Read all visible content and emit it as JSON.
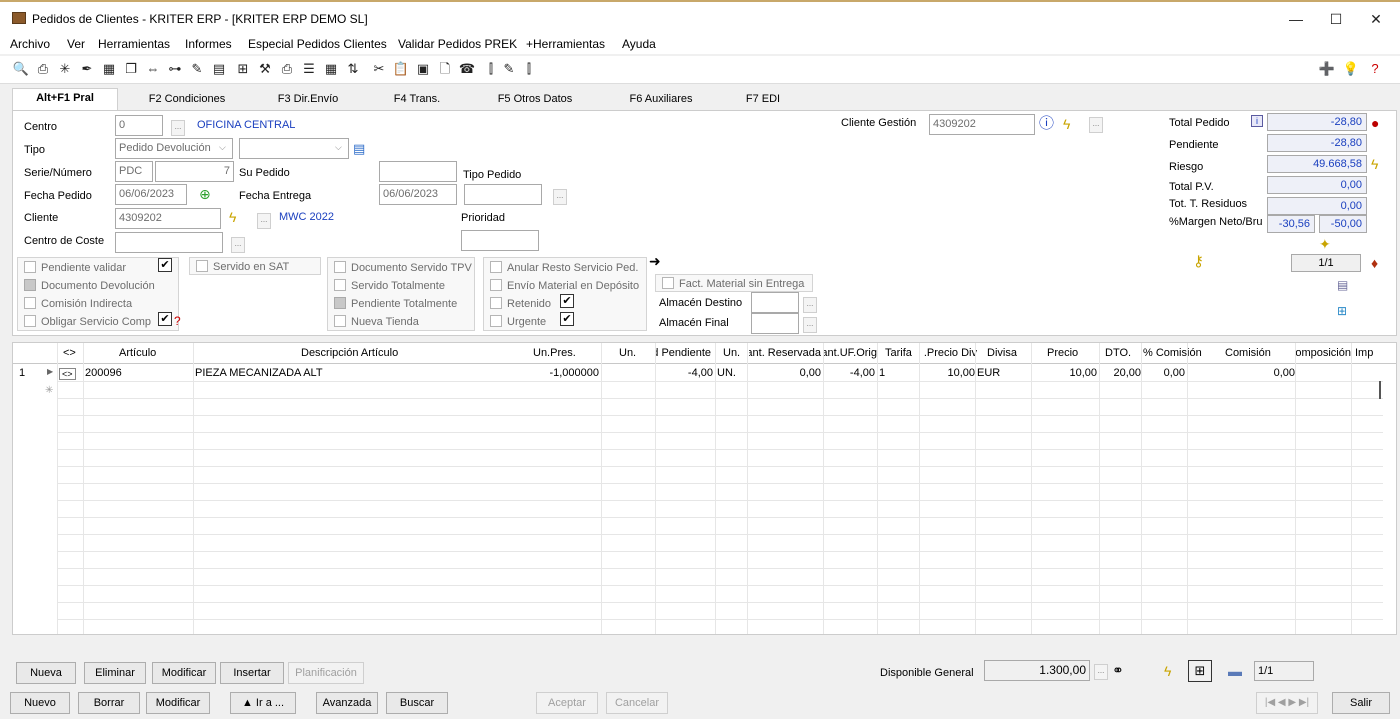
{
  "window": {
    "title": "Pedidos de Clientes - KRITER ERP - [KRITER ERP DEMO SL]",
    "minimize": "—",
    "maximize": "☐",
    "close": "✕"
  },
  "menu": [
    "Archivo",
    "Ver",
    "Herramientas",
    "Informes",
    "Especial Pedidos Clientes",
    "Validar Pedidos PREK",
    "+Herramientas",
    "Ayuda"
  ],
  "tabs": [
    "Alt+F1 Pral",
    "F2 Condiciones",
    "F3 Dir.Envío",
    "F4 Trans.",
    "F5 Otros Datos",
    "F6 Auxiliares",
    "F7 EDI"
  ],
  "form": {
    "centro_label": "Centro",
    "centro_value": "0",
    "centro_name": "OFICINA CENTRAL",
    "tipo_label": "Tipo",
    "tipo_value": "Pedido Devolución",
    "serie_label": "Serie/Número",
    "serie_value": "PDC",
    "numero_value": "7",
    "su_pedido_label": "Su Pedido",
    "fecha_pedido_label": "Fecha Pedido",
    "fecha_pedido_value": "06/06/2023",
    "fecha_entrega_label": "Fecha Entrega",
    "fecha_entrega_value": "06/06/2023",
    "tipo_pedido_label": "Tipo Pedido",
    "cliente_label": "Cliente",
    "cliente_value": "4309202",
    "cliente_name": "MWC 2022",
    "prioridad_label": "Prioridad",
    "centro_coste_label": "Centro de Coste",
    "cliente_gestion_label": "Cliente Gestión",
    "cliente_gestion_value": "4309202",
    "ellipsis": "...",
    "dropdown_arrow": "⌵"
  },
  "checks": {
    "pendiente_validar": "Pendiente validar",
    "documento_devolucion": "Documento Devolución",
    "comision_indirecta": "Comisión Indirecta",
    "obligar_servicio": "Obligar Servicio Comp",
    "servido_sat": "Servido en SAT",
    "documento_servido_tpv": "Documento Servido TPV",
    "servido_totalmente": "Servido Totalmente",
    "pendiente_totalmente": "Pendiente Totalmente",
    "nueva_tienda": "Nueva Tienda",
    "anular_resto": "Anular Resto Servicio Ped.",
    "envio_material": "Envío Material en Depósito",
    "retenido": "Retenido",
    "urgente": "Urgente",
    "fact_material": "Fact. Material sin Entrega",
    "almacen_destino": "Almacén Destino",
    "almacen_final": "Almacén Final",
    "checkmark": "✔"
  },
  "totals": {
    "total_pedido_label": "Total Pedido",
    "total_pedido_value": "-28,80",
    "pendiente_label": "Pendiente",
    "pendiente_value": "-28,80",
    "riesgo_label": "Riesgo",
    "riesgo_value": "49.668,58",
    "total_pv_label": "Total P.V.",
    "total_pv_value": "0,00",
    "tot_residuos_label": "Tot. T. Residuos",
    "tot_residuos_value": "0,00",
    "margen_label": "%Margen Neto/Bru",
    "margen_neto": "-30,56",
    "margen_bruto": "-50,00",
    "pager": "1/1",
    "info_badge": "i"
  },
  "grid": {
    "headers": [
      "<>",
      "Artículo",
      "Descripción Artículo",
      "Un.Pres.",
      "Un.",
      "Cantidad Pendiente",
      "Un.",
      "Cant. Reservada",
      "Cant.UF.Orig",
      "Tarifa",
      "Precio Div.",
      "Divisa",
      "Precio",
      "DTO.",
      "% Comisión",
      "Comisión",
      "Composición",
      "Imp"
    ],
    "rows": [
      {
        "num": "1",
        "marker": "▶",
        "toggle": "<>",
        "articulo": "200096",
        "descripcion": "PIEZA MECANIZADA ALT",
        "un_pres": "-1,000000",
        "un": "",
        "cant_pend": "-4,00",
        "un2": "UN.",
        "cant_res": "0,00",
        "cant_uf": "-4,00",
        "tarifa": "1",
        "precio_div": "10,00",
        "divisa": "EUR",
        "precio": "10,00",
        "dto": "20,00",
        "pct_comision": "0,00",
        "comision": "0,00"
      }
    ],
    "new_row_marker": "✳"
  },
  "buttons_row1": {
    "nueva": "Nueva",
    "eliminar": "Eliminar",
    "modificar": "Modificar",
    "insertar": "Insertar",
    "planificacion": "Planificación",
    "disponible_label": "Disponible General",
    "disponible_value": "1.300,00",
    "pager": "1/1"
  },
  "buttons_row2": {
    "nuevo": "Nuevo",
    "borrar": "Borrar",
    "modificar": "Modificar",
    "ir_a": "▲ Ir a ...",
    "avanzada": "Avanzada",
    "buscar": "Buscar",
    "aceptar": "Aceptar",
    "cancelar": "Cancelar",
    "nav": "|◀ ◀ ▶ ▶|",
    "salir": "Salir"
  }
}
